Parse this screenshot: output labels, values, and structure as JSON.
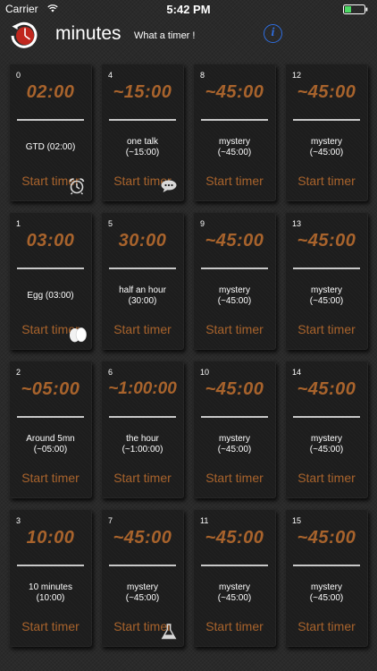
{
  "status_bar": {
    "carrier": "Carrier",
    "time": "5:42 PM"
  },
  "header": {
    "title": "minutes",
    "subtitle": "What a timer !",
    "info_icon": "info-circle-icon",
    "accent_color": "#2f6ee0"
  },
  "colors": {
    "timer_text": "#a8632c",
    "card_bg": "#1d1d1d"
  },
  "timers": [
    {
      "index": "0",
      "time": "02:00",
      "label": "GTD (02:00)",
      "start": "Start timer",
      "icon": "alarm-clock-icon"
    },
    {
      "index": "4",
      "time": "~15:00",
      "label": "one talk\n(~15:00)",
      "start": "Start timer",
      "icon": "speech-bubble-icon"
    },
    {
      "index": "8",
      "time": "~45:00",
      "label": "mystery\n(~45:00)",
      "start": "Start timer",
      "icon": ""
    },
    {
      "index": "12",
      "time": "~45:00",
      "label": "mystery\n(~45:00)",
      "start": "Start timer",
      "icon": ""
    },
    {
      "index": "1",
      "time": "03:00",
      "label": "Egg (03:00)",
      "start": "Start timer",
      "icon": "egg-icon"
    },
    {
      "index": "5",
      "time": "30:00",
      "label": "half an hour\n(30:00)",
      "start": "Start timer",
      "icon": ""
    },
    {
      "index": "9",
      "time": "~45:00",
      "label": "mystery\n(~45:00)",
      "start": "Start timer",
      "icon": ""
    },
    {
      "index": "13",
      "time": "~45:00",
      "label": "mystery\n(~45:00)",
      "start": "Start timer",
      "icon": ""
    },
    {
      "index": "2",
      "time": "~05:00",
      "label": "Around 5mn\n(~05:00)",
      "start": "Start timer",
      "icon": ""
    },
    {
      "index": "6",
      "time": "~1:00:00",
      "label": "the hour\n(~1:00:00)",
      "start": "Start timer",
      "icon": ""
    },
    {
      "index": "10",
      "time": "~45:00",
      "label": "mystery\n(~45:00)",
      "start": "Start timer",
      "icon": ""
    },
    {
      "index": "14",
      "time": "~45:00",
      "label": "mystery\n(~45:00)",
      "start": "Start timer",
      "icon": ""
    },
    {
      "index": "3",
      "time": "10:00",
      "label": "10 minutes\n(10:00)",
      "start": "Start timer",
      "icon": ""
    },
    {
      "index": "7",
      "time": "~45:00",
      "label": "mystery\n(~45:00)",
      "start": "Start timer",
      "icon": "flask-icon"
    },
    {
      "index": "11",
      "time": "~45:00",
      "label": "mystery\n(~45:00)",
      "start": "Start timer",
      "icon": ""
    },
    {
      "index": "15",
      "time": "~45:00",
      "label": "mystery\n(~45:00)",
      "start": "Start timer",
      "icon": ""
    }
  ]
}
